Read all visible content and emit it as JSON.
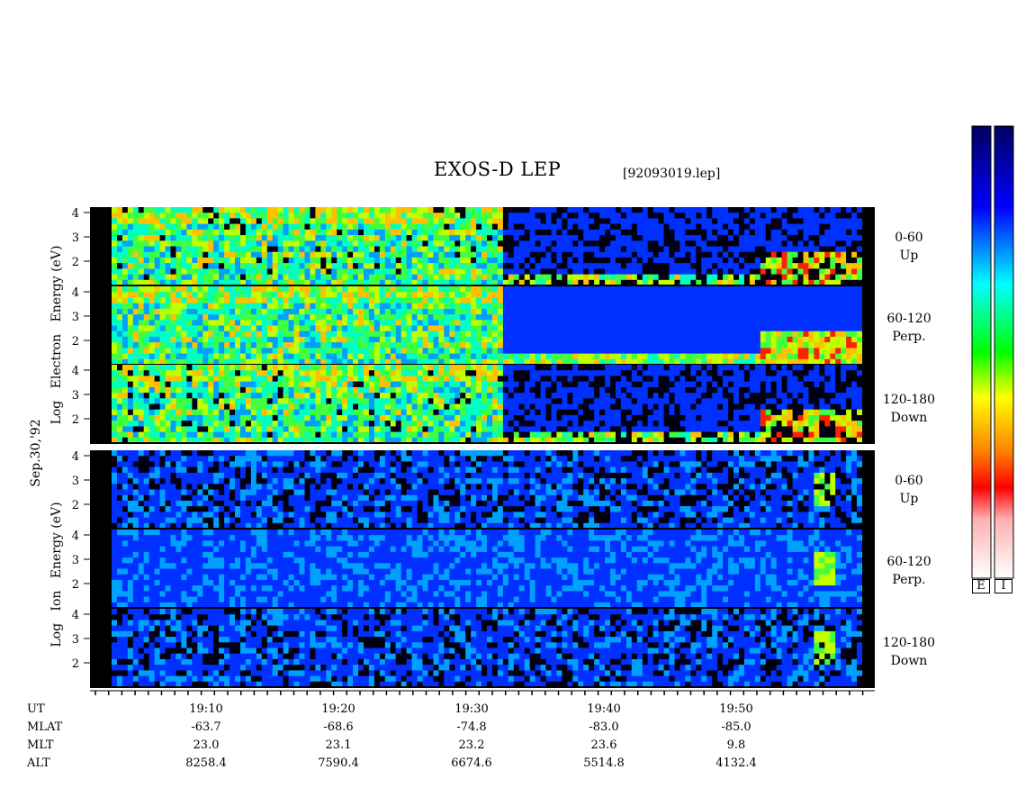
{
  "title": "EXOS-D LEP",
  "filename": "[92093019.lep]",
  "date_label": "Sep.30,'92",
  "electron_ylabel": "Log   Electron   Energy (eV)",
  "ion_ylabel": "Log   Ion   Energy (eV)",
  "y_ticks": [
    "4",
    "3",
    "2"
  ],
  "pitch_bands": [
    {
      "range": "0-60",
      "dir": "Up"
    },
    {
      "range": "60-120",
      "dir": "Perp."
    },
    {
      "range": "120-180",
      "dir": "Down"
    }
  ],
  "colorbar": {
    "labels": [
      "E",
      "I"
    ]
  },
  "ephemeris": {
    "row_labels": [
      "UT",
      "MLAT",
      "MLT",
      "ALT"
    ],
    "ut": [
      "19:10",
      "19:20",
      "19:30",
      "19:40",
      "19:50"
    ],
    "mlat": [
      "-63.7",
      "-68.6",
      "-74.8",
      "-83.0",
      "-85.0"
    ],
    "mlt": [
      "23.0",
      "23.1",
      "23.2",
      "23.6",
      "9.8"
    ],
    "alt": [
      "8258.4",
      "7590.4",
      "6674.6",
      "5514.8",
      "4132.4"
    ]
  },
  "chart_data": {
    "type": "heatmap",
    "title": "EXOS-D LEP",
    "x_axis": "UT",
    "x_ticks": [
      "19:10",
      "19:20",
      "19:30",
      "19:40",
      "19:50"
    ],
    "x_range": [
      "19:02",
      "19:59"
    ],
    "y_label_electron": "Log Electron Energy (eV)",
    "y_label_ion": "Log Ion Energy (eV)",
    "y_range": [
      1,
      4
    ],
    "panels": [
      {
        "species": "electron",
        "pitch_angle": "0-60",
        "direction": "Up"
      },
      {
        "species": "electron",
        "pitch_angle": "60-120",
        "direction": "Perp."
      },
      {
        "species": "electron",
        "pitch_angle": "120-180",
        "direction": "Down"
      },
      {
        "species": "ion",
        "pitch_angle": "0-60",
        "direction": "Up"
      },
      {
        "species": "ion",
        "pitch_angle": "60-120",
        "direction": "Perp."
      },
      {
        "species": "ion",
        "pitch_angle": "120-180",
        "direction": "Down"
      }
    ],
    "colorbars": [
      "E",
      "I"
    ]
  }
}
